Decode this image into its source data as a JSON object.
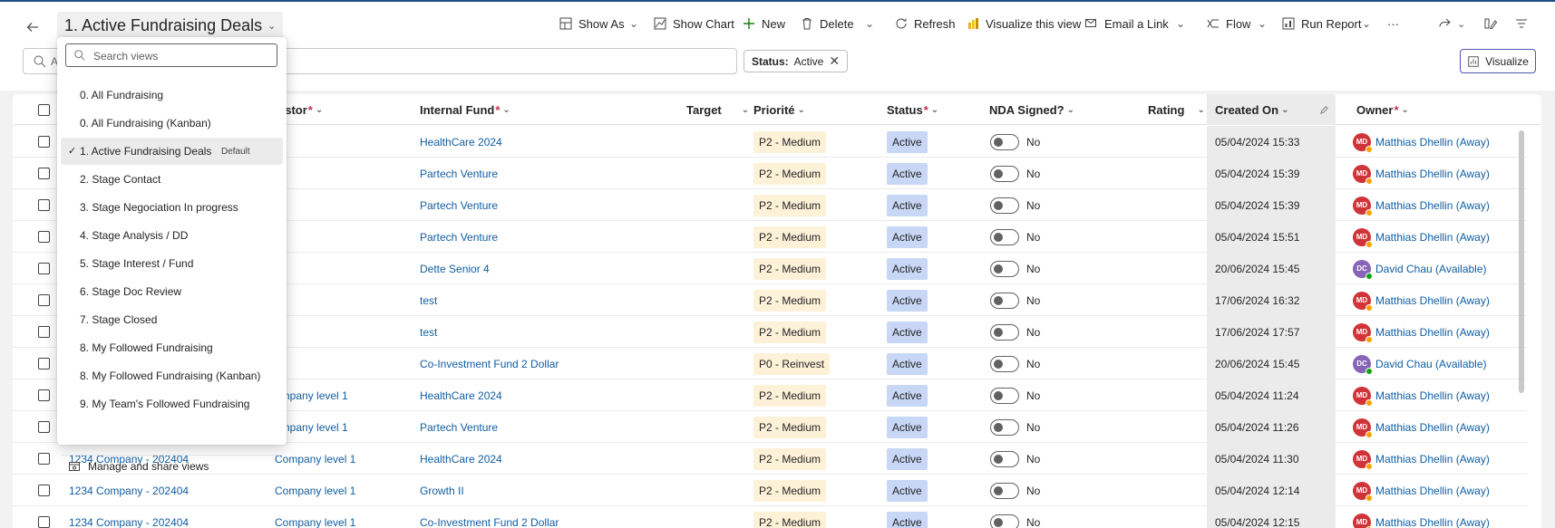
{
  "header": {
    "title": "1. Active Fundraising Deals",
    "search_placeholder": "A"
  },
  "commands": {
    "show_as": "Show As",
    "show_chart": "Show Chart",
    "new": "New",
    "delete": "Delete",
    "refresh": "Refresh",
    "visualize_view": "Visualize this view",
    "email_link": "Email a Link",
    "flow": "Flow",
    "run_report": "Run Report",
    "more": "···"
  },
  "filter_chip": {
    "label": "Status:",
    "value": "Active"
  },
  "visualize_button": "Visualize",
  "columns": {
    "investor": "estor",
    "internal_fund": "Internal Fund",
    "target": "Target",
    "priority": "Priorité",
    "status": "Status",
    "nda": "NDA Signed?",
    "rating": "Rating",
    "created_on": "Created On",
    "owner": "Owner"
  },
  "rows": [
    {
      "name": "",
      "investor": "",
      "fund": "HealthCare 2024",
      "priority": "P2 - Medium",
      "status": "Active",
      "nda": "No",
      "created": "05/04/2024 15:33",
      "owner": "Matthias Dhellin (Away)",
      "initials": "MD"
    },
    {
      "name": "",
      "investor": "",
      "fund": "Partech Venture",
      "priority": "P2 - Medium",
      "status": "Active",
      "nda": "No",
      "created": "05/04/2024 15:39",
      "owner": "Matthias Dhellin (Away)",
      "initials": "MD"
    },
    {
      "name": "",
      "investor": "",
      "fund": "Partech Venture",
      "priority": "P2 - Medium",
      "status": "Active",
      "nda": "No",
      "created": "05/04/2024 15:39",
      "owner": "Matthias Dhellin (Away)",
      "initials": "MD"
    },
    {
      "name": "",
      "investor": "",
      "fund": "Partech Venture",
      "priority": "P2 - Medium",
      "status": "Active",
      "nda": "No",
      "created": "05/04/2024 15:51",
      "owner": "Matthias Dhellin (Away)",
      "initials": "MD"
    },
    {
      "name": "",
      "investor": "",
      "fund": "Dette Senior 4",
      "priority": "P2 - Medium",
      "status": "Active",
      "nda": "No",
      "created": "20/06/2024 15:45",
      "owner": "David Chau (Available)",
      "initials": "DC"
    },
    {
      "name": "",
      "investor": "",
      "fund": "test",
      "priority": "P2 - Medium",
      "status": "Active",
      "nda": "No",
      "created": "17/06/2024 16:32",
      "owner": "Matthias Dhellin (Away)",
      "initials": "MD"
    },
    {
      "name": "",
      "investor": "",
      "fund": "test",
      "priority": "P2 - Medium",
      "status": "Active",
      "nda": "No",
      "created": "17/06/2024 17:57",
      "owner": "Matthias Dhellin (Away)",
      "initials": "MD"
    },
    {
      "name": "",
      "investor": "",
      "fund": "Co-Investment Fund 2 Dollar",
      "priority": "P0 - Reinvest",
      "status": "Active",
      "nda": "No",
      "created": "20/06/2024 15:45",
      "owner": "David Chau (Available)",
      "initials": "DC"
    },
    {
      "name": "",
      "investor": "ompany level 1",
      "fund": "HealthCare 2024",
      "priority": "P2 - Medium",
      "status": "Active",
      "nda": "No",
      "created": "05/04/2024 11:24",
      "owner": "Matthias Dhellin (Away)",
      "initials": "MD"
    },
    {
      "name": "",
      "investor": "ompany level 1",
      "fund": "Partech Venture",
      "priority": "P2 - Medium",
      "status": "Active",
      "nda": "No",
      "created": "05/04/2024 11:26",
      "owner": "Matthias Dhellin (Away)",
      "initials": "MD"
    },
    {
      "name": "1234 Company - 202404",
      "investor": "Company level 1",
      "fund": "HealthCare 2024",
      "priority": "P2 - Medium",
      "status": "Active",
      "nda": "No",
      "created": "05/04/2024 11:30",
      "owner": "Matthias Dhellin (Away)",
      "initials": "MD"
    },
    {
      "name": "1234 Company - 202404",
      "investor": "Company level 1",
      "fund": "Growth II",
      "priority": "P2 - Medium",
      "status": "Active",
      "nda": "No",
      "created": "05/04/2024 12:14",
      "owner": "Matthias Dhellin (Away)",
      "initials": "MD"
    },
    {
      "name": "1234 Company - 202404",
      "investor": "Company level 1",
      "fund": "Co-Investment Fund 2 Dollar",
      "priority": "P2 - Medium",
      "status": "Active",
      "nda": "No",
      "created": "05/04/2024 12:15",
      "owner": "Matthias Dhellin (Away)",
      "initials": "MD"
    }
  ],
  "colors": {
    "md_avatar": "#d13438",
    "dc_avatar": "#8764b8",
    "away_dot": "#f8a000",
    "available_dot": "#13a10e"
  },
  "views_dropdown": {
    "search_placeholder": "Search views",
    "default_badge": "Default",
    "items": [
      "0. All Fundraising",
      "0. All Fundraising (Kanban)",
      "1. Active Fundraising Deals",
      "2. Stage Contact",
      "3. Stage Negociation In progress",
      "4. Stage Analysis / DD",
      "5. Stage Interest / Fund",
      "6. Stage Doc Review",
      "7. Stage Closed",
      "8. My Followed Fundraising",
      "8. My Followed Fundraising (Kanban)",
      "9. My Team's Followed Fundraising"
    ],
    "manage_label": "Manage and share views"
  }
}
